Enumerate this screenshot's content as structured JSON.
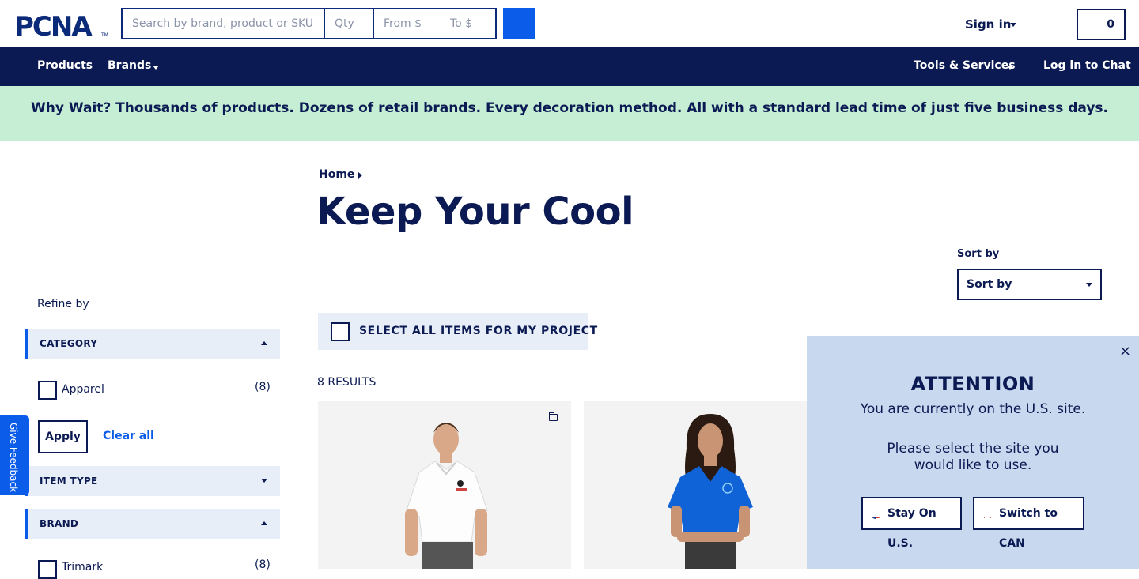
{
  "header": {
    "logo_text": "PCNA",
    "search_placeholder": "Search by brand, product or SKU",
    "qty_placeholder": "Qty",
    "price_from_placeholder": "From $",
    "price_to_placeholder": "To $",
    "sign_in_label": "Sign in",
    "cart_count": "0"
  },
  "nav": {
    "products": "Products",
    "brands": "Brands",
    "tools_services": "Tools & Services",
    "chat": "Log in to Chat"
  },
  "banner": {
    "text": "Why Wait? Thousands of products. Dozens of retail brands. Every decoration method. All with a standard lead time of just five business days."
  },
  "breadcrumb": {
    "home": "Home"
  },
  "page_title": "Keep Your Cool",
  "sort": {
    "label": "Sort by",
    "selected": "Sort by"
  },
  "select_all_label": "SELECT ALL ITEMS FOR MY PROJECT",
  "results_count": "8 RESULTS",
  "sidebar": {
    "refine_by": "Refine by",
    "facets": [
      {
        "name": "CATEGORY",
        "expanded": true,
        "options": [
          {
            "label": "Apparel",
            "count": "(8)"
          }
        ]
      },
      {
        "name": "ITEM TYPE",
        "expanded": false
      },
      {
        "name": "BRAND",
        "expanded": true,
        "options": [
          {
            "label": "Trimark",
            "count": "(8)"
          }
        ]
      }
    ],
    "apply_label": "Apply",
    "clear_all_label": "Clear all"
  },
  "feedback_label": "Give Feedback",
  "popup": {
    "title": "ATTENTION",
    "line1": "You are currently on the U.S. site.",
    "line2": "Please select the site you",
    "line3": "would like to use.",
    "stay_label": "Stay On U.S.",
    "switch_label": "Switch to CAN",
    "close_symbol": "×"
  },
  "colors": {
    "navy": "#0b1a52",
    "accent_blue": "#0b5ce8",
    "banner_green": "#c5eed5",
    "popup_bg": "#c7d8ef",
    "facet_bg": "#e8eef8"
  }
}
